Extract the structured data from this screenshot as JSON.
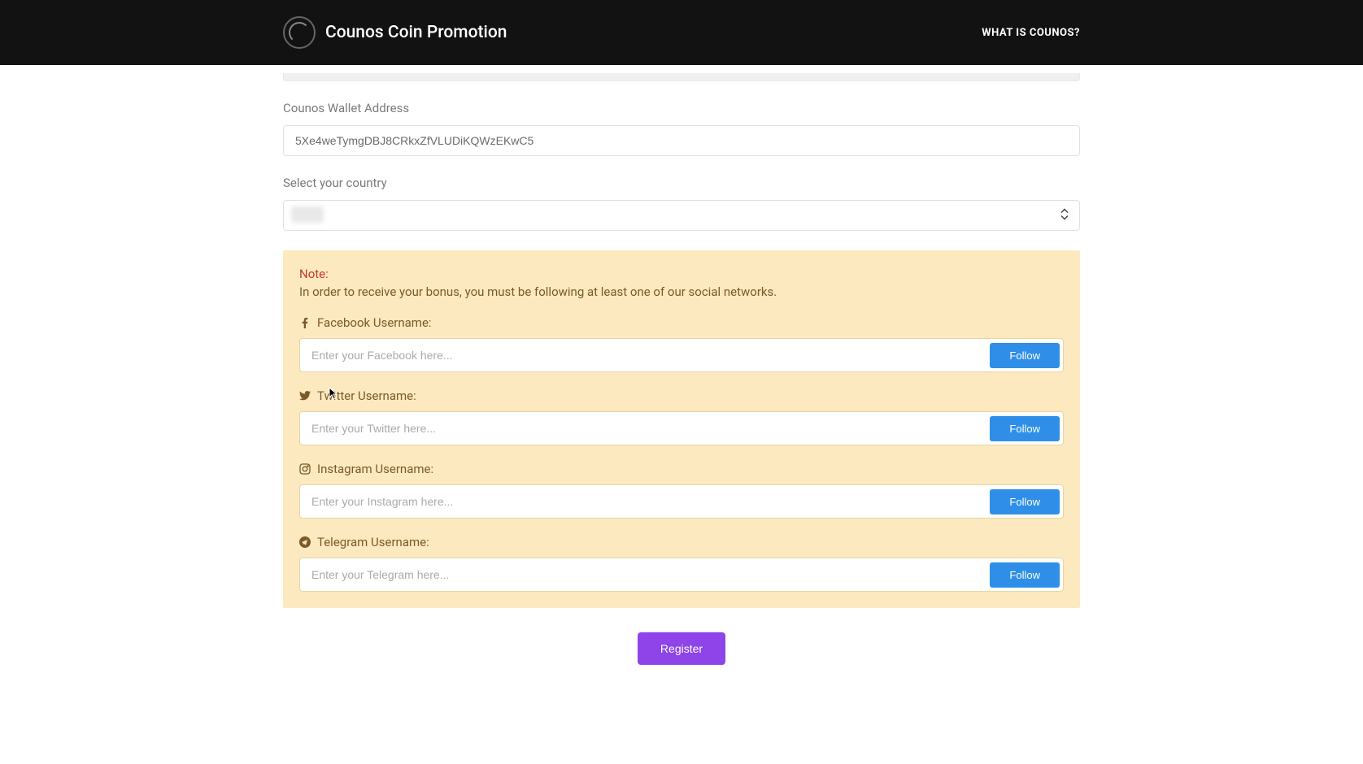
{
  "header": {
    "brand": "Counos Coin Promotion",
    "nav_link": "WHAT IS COUNOS?"
  },
  "form": {
    "wallet_label": "Counos Wallet Address",
    "wallet_value": "5Xe4weTymgDBJ8CRkxZfVLUDiKQWzEKwC5",
    "country_label": "Select your country",
    "country_value": ""
  },
  "note": {
    "title": "Note:",
    "text": "In order to receive your bonus, you must be following at least one of our social networks."
  },
  "social": {
    "facebook": {
      "label": "Facebook Username:",
      "placeholder": "Enter your Facebook here...",
      "button": "Follow"
    },
    "twitter": {
      "label": "Twitter Username:",
      "placeholder": "Enter your Twitter here...",
      "button": "Follow"
    },
    "instagram": {
      "label": "Instagram Username:",
      "placeholder": "Enter your Instagram here...",
      "button": "Follow"
    },
    "telegram": {
      "label": "Telegram Username:",
      "placeholder": "Enter your Telegram here...",
      "button": "Follow"
    }
  },
  "register_button": "Register"
}
